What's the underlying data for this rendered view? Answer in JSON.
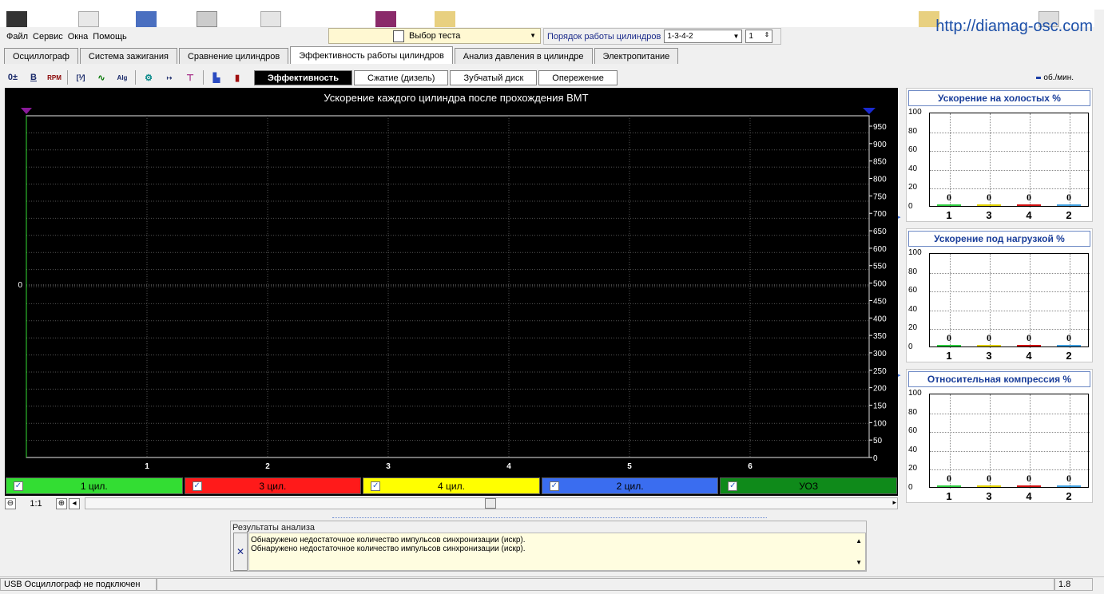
{
  "url": "http://diamag-osc.com",
  "menu": [
    "Файл",
    "Сервис",
    "Окна",
    "Помощь"
  ],
  "test_select": {
    "value": "Выбор теста"
  },
  "cyl_order": {
    "label": "Порядок работы цилиндров",
    "value": "1-3-4-2",
    "spin_value": "1"
  },
  "main_tabs": [
    "Осциллограф",
    "Система зажигания",
    "Сравнение цилиндров",
    "Эффективность работы цилиндров",
    "Анализ давления в цилиндре",
    "Электропитание"
  ],
  "main_tab_active": 3,
  "sub_tabs": [
    "Эффективность",
    "Сжатие (дизель)",
    "Зубчатый диск",
    "Опережение"
  ],
  "sub_tab_active": 0,
  "toolbar_icons": [
    "zoom-y-icon",
    "bold-b-icon",
    "rpm-icon",
    "scale-icon",
    "wave-icon",
    "algo-icon",
    "net-icon",
    "counter-icon",
    "filter-icon",
    "cars-icon",
    "bar-chart-icon"
  ],
  "rpm_unit": "об./мин.",
  "chart_data": {
    "type": "line",
    "title": "Ускорение каждого цилиндра после прохождения ВМТ",
    "x_ticks": [
      "1",
      "2",
      "3",
      "4",
      "5",
      "6"
    ],
    "y_left_ticks": [
      "0"
    ],
    "y_right_ticks": [
      "950",
      "900",
      "850",
      "800",
      "750",
      "700",
      "650",
      "600",
      "550",
      "500",
      "450",
      "400",
      "350",
      "300",
      "250",
      "200",
      "150",
      "100",
      "50",
      "0"
    ],
    "y_right_range": [
      0,
      950
    ],
    "grid": true,
    "series": []
  },
  "legend": [
    {
      "label": "1 цил.",
      "color": "#33dd33",
      "checked": true
    },
    {
      "label": "3 цил.",
      "color": "#ff1a1a",
      "checked": true
    },
    {
      "label": "4 цил.",
      "color": "#ffff00",
      "checked": true
    },
    {
      "label": "2 цил.",
      "color": "#3a6df0",
      "checked": true
    },
    {
      "label": "УОЗ",
      "color": "#0f8a1a",
      "checked": true
    }
  ],
  "zoom": {
    "value": "1:1"
  },
  "results": {
    "label": "Результаты анализа",
    "lines": [
      "Обнаружено недостаточное количество импульсов синхронизации (искр).",
      "Обнаружено недостаточное количество импульсов синхронизации (искр)."
    ]
  },
  "status": {
    "text": "USB Осциллограф не подключен",
    "version": "1.8"
  },
  "mini_charts": [
    {
      "title": "Ускорение на холостых %",
      "y_ticks": [
        "100",
        "80",
        "60",
        "40",
        "20",
        "0"
      ],
      "categories": [
        "1",
        "3",
        "4",
        "2"
      ],
      "values": [
        0,
        0,
        0,
        0
      ],
      "value_labels": [
        "0",
        "0",
        "0",
        "0"
      ],
      "colors": [
        "#2ecc40",
        "#e0d000",
        "#d01010",
        "#40a0e0"
      ]
    },
    {
      "title": "Ускорение под нагрузкой %",
      "y_ticks": [
        "100",
        "80",
        "60",
        "40",
        "20",
        "0"
      ],
      "categories": [
        "1",
        "3",
        "4",
        "2"
      ],
      "values": [
        0,
        0,
        0,
        0
      ],
      "value_labels": [
        "0",
        "0",
        "0",
        "0"
      ],
      "colors": [
        "#2ecc40",
        "#e0d000",
        "#d01010",
        "#40a0e0"
      ]
    },
    {
      "title": "Относительная компрессия %",
      "y_ticks": [
        "100",
        "80",
        "60",
        "40",
        "20",
        "0"
      ],
      "categories": [
        "1",
        "3",
        "4",
        "2"
      ],
      "values": [
        0,
        0,
        0,
        0
      ],
      "value_labels": [
        "0",
        "0",
        "0",
        "0"
      ],
      "colors": [
        "#2ecc40",
        "#e0d000",
        "#d01010",
        "#40a0e0"
      ]
    }
  ]
}
